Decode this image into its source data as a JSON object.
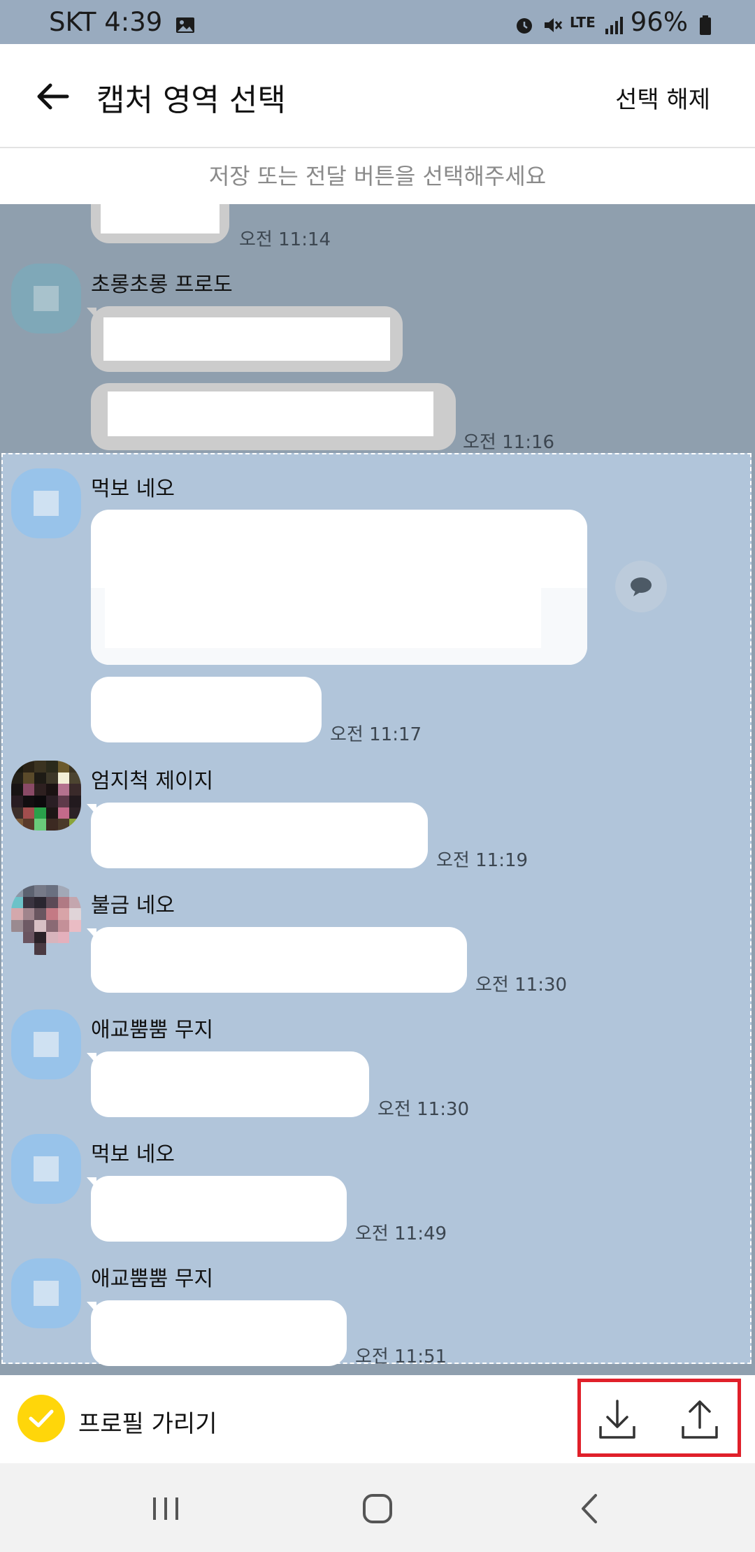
{
  "status_bar": {
    "carrier_time": "SKT 4:39",
    "network": "LTE",
    "battery": "96%",
    "icons": [
      "image-icon",
      "alarm-icon",
      "mute-icon",
      "signal-icon",
      "battery-icon"
    ]
  },
  "app_bar": {
    "title": "캡처 영역 선택",
    "deselect_label": "선택 해제"
  },
  "hint": "저장 또는 전달 버튼을 선택해주세요",
  "messages": [
    {
      "sender": "",
      "time": "오전 11:14"
    },
    {
      "sender": "초롱초롱 프로도",
      "time": "오전 11:16"
    },
    {
      "sender": "먹보 네오",
      "time": "오전 11:17"
    },
    {
      "sender": "엄지척 제이지",
      "time": "오전 11:19"
    },
    {
      "sender": "불금 네오",
      "time": "오전 11:30"
    },
    {
      "sender": "애교뿜뿜 무지",
      "time": "오전 11:30"
    },
    {
      "sender": "먹보 네오",
      "time": "오전 11:49"
    },
    {
      "sender": "애교뿜뿜 무지",
      "time": "오전 11:51"
    }
  ],
  "bottom_bar": {
    "hide_profile_label": "프로필 가리기",
    "hide_profile_checked": true
  },
  "colors": {
    "chat_bg": "#8f9fae",
    "selection_bg": "#b1c5da",
    "check_yellow": "#ffd60a",
    "highlight_red": "#e0202a"
  }
}
